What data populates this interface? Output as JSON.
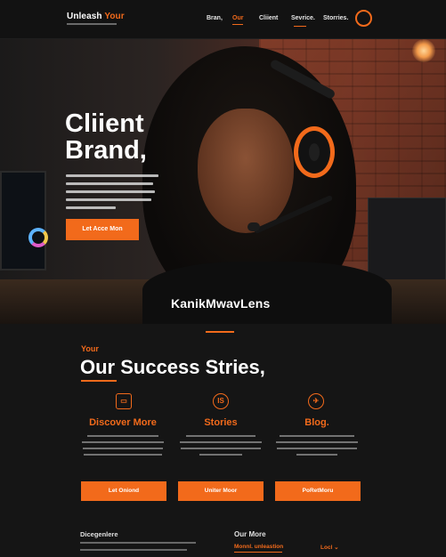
{
  "nav": {
    "logo_main": "Unleash ",
    "logo_accent": "Your",
    "links": [
      {
        "label": "Bran,"
      },
      {
        "label": "Our"
      },
      {
        "label": "Cliient"
      },
      {
        "label": "Sevrice."
      },
      {
        "label": "Storries."
      }
    ],
    "active_index": 1
  },
  "hero": {
    "title_line1": "Cliient",
    "title_line2": "Brand,",
    "cta_label": "Let Acce Mon",
    "watermark": "KanikMwavLens"
  },
  "section": {
    "eyebrow": "Your",
    "title": "Our Success Stries,",
    "columns": [
      {
        "icon": "storefront-icon",
        "glyph": "▭",
        "title": "Discover More",
        "button": "Let Oniond"
      },
      {
        "icon": "tag-icon",
        "glyph": "IS",
        "title": "Stories",
        "button": "Uniter Moor"
      },
      {
        "icon": "plane-icon",
        "glyph": "✈",
        "title": "Blog.",
        "button": "PoRetMoru"
      }
    ]
  },
  "footer": {
    "left_title": "Dicegenlere",
    "right_title": "Our More",
    "right_sub_left": "Monnl. unleastion",
    "right_sub_right": "Locl ⌄"
  },
  "colors": {
    "accent": "#f26a1b",
    "background": "#151515"
  }
}
